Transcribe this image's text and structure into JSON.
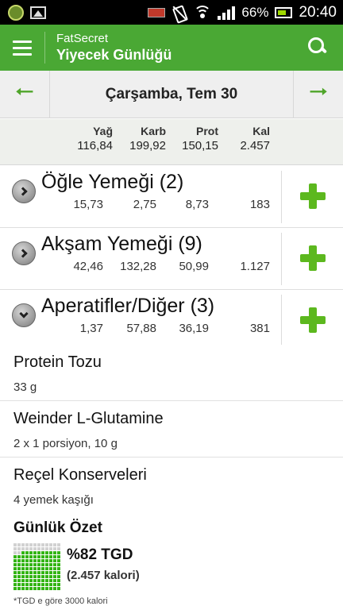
{
  "status_bar": {
    "battery_percent": "66%",
    "time": "20:40",
    "icons": [
      "app-icon",
      "image-icon",
      "battery-low-icon",
      "mute-icon",
      "wifi-icon",
      "signal-icon",
      "battery-icon"
    ]
  },
  "app_bar": {
    "app_name": "FatSecret",
    "page_title": "Yiyecek Günlüğü",
    "icons": [
      "menu-icon",
      "search-icon"
    ],
    "color": "#4aa834"
  },
  "date_nav": {
    "date": "Çarşamba, Tem 30",
    "icons": [
      "arrow-left-icon",
      "arrow-right-icon"
    ],
    "arrow_color": "#4fa52a"
  },
  "totals": {
    "headers": [
      "Yağ",
      "Karb",
      "Prot",
      "Kal"
    ],
    "values": [
      "116,84",
      "199,92",
      "150,15",
      "2.457"
    ]
  },
  "meals": [
    {
      "name": "Öğle Yemeği (2)",
      "expanded": false,
      "values": [
        "15,73",
        "2,75",
        "8,73",
        "183"
      ]
    },
    {
      "name": "Akşam Yemeği (9)",
      "expanded": false,
      "values": [
        "42,46",
        "132,28",
        "50,99",
        "1.127"
      ]
    },
    {
      "name": "Aperatifler/Diğer (3)",
      "expanded": true,
      "values": [
        "1,37",
        "57,88",
        "36,19",
        "381"
      ]
    }
  ],
  "foods": [
    {
      "name": "Protein Tozu",
      "qty": "33 g"
    },
    {
      "name": "Weinder L-Glutamine",
      "qty": "2  x 1 porsiyon, 10 g"
    },
    {
      "name": "Reçel Konserveleri",
      "qty": "4 yemek kaşığı"
    }
  ],
  "summary": {
    "title": "Günlük Özet",
    "rdi_percent": 82,
    "rdi_label": "%82 TGD",
    "calories_label": "(2.457 kalori)",
    "footnote": "*TGD e göre 3000 kalori",
    "fill_color": "#33b414"
  }
}
